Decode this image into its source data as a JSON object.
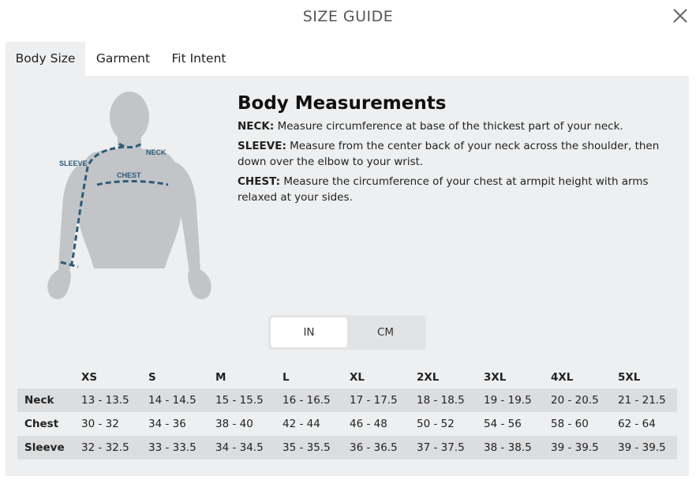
{
  "modal": {
    "title": "SIZE GUIDE",
    "close_icon": "close-icon"
  },
  "tabs": [
    {
      "label": "Body Size",
      "active": true
    },
    {
      "label": "Garment",
      "active": false
    },
    {
      "label": "Fit Intent",
      "active": false
    }
  ],
  "figure": {
    "labels": {
      "sleeve": "SLEEVE",
      "neck": "NECK",
      "chest": "CHEST"
    },
    "colors": {
      "body": "#c2c4c7",
      "line": "#2b5a79",
      "text": "#2b5a79"
    }
  },
  "measurements": {
    "title": "Body Measurements",
    "items": [
      {
        "term": "NECK:",
        "text": " Measure circumference at base of the thickest part of your neck."
      },
      {
        "term": "SLEEVE:",
        "text": " Measure from the center back of your neck across the shoulder, then down over the elbow to your wrist."
      },
      {
        "term": "CHEST:",
        "text": " Measure the circumference of your chest at armpit height with arms relaxed at your sides."
      }
    ]
  },
  "unit_toggle": {
    "options": [
      "IN",
      "CM"
    ],
    "selected": "IN"
  },
  "size_table": {
    "headers": [
      "",
      "XS",
      "S",
      "M",
      "L",
      "XL",
      "2XL",
      "3XL",
      "4XL",
      "5XL"
    ],
    "rows": [
      {
        "label": "Neck",
        "values": [
          "13 - 13.5",
          "14 - 14.5",
          "15 - 15.5",
          "16 - 16.5",
          "17 - 17.5",
          "18 - 18.5",
          "19 - 19.5",
          "20 - 20.5",
          "21 - 21.5"
        ]
      },
      {
        "label": "Chest",
        "values": [
          "30 - 32",
          "34 - 36",
          "38 - 40",
          "42 - 44",
          "46 - 48",
          "50 - 52",
          "54 - 56",
          "58 - 60",
          "62 - 64"
        ]
      },
      {
        "label": "Sleeve",
        "values": [
          "32 - 32.5",
          "33 - 33.5",
          "34 - 34.5",
          "35 - 35.5",
          "36 - 36.5",
          "37 - 37.5",
          "38 - 38.5",
          "39 - 39.5",
          "39 - 39.5"
        ]
      }
    ]
  }
}
